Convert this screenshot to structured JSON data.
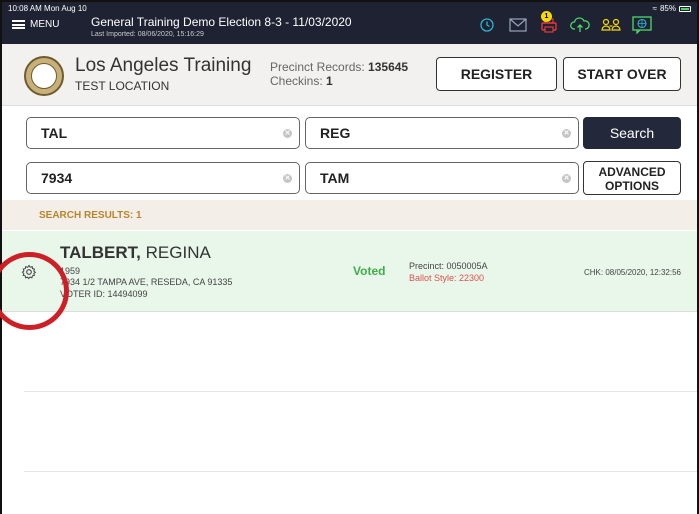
{
  "status_bar": {
    "time": "10:08 AM  Mon Aug 10",
    "battery": "85%"
  },
  "topbar": {
    "menu_label": "MENU",
    "title": "General Training  Demo Election 8-3 - 11/03/2020",
    "subtitle": "Last Imported: 08/06/2020, 15:16:29",
    "notification_count": "1",
    "icons": [
      "history-icon",
      "mail-icon",
      "printer-icon",
      "cloud-upload-icon",
      "users-icon",
      "chat-icon"
    ]
  },
  "header": {
    "org_name": "Los Angeles Training",
    "location": "TEST LOCATION",
    "precinct_records_label": "Precinct Records:",
    "precinct_records_value": "135645",
    "checkins_label": "Checkins:",
    "checkins_value": "1",
    "register_label": "REGISTER",
    "start_over_label": "START OVER"
  },
  "search": {
    "last_name": "TAL",
    "first_name": "REG",
    "house_number": "7934",
    "street": "TAM",
    "search_label": "Search",
    "advanced_line1": "ADVANCED",
    "advanced_line2": "OPTIONS"
  },
  "results": {
    "header": "SEARCH RESULTS: 1",
    "items": [
      {
        "last_name": "TALBERT,",
        "first_name": " REGINA",
        "birth_year": "1959",
        "address": "7934 1/2 TAMPA AVE, RESEDA, CA 91335",
        "voter_id": "VOTER ID: 14494099",
        "status": "Voted",
        "precinct": "Precinct: 0050005A",
        "ballot_style": "Ballot Style: 22300",
        "checked": "CHK: 08/05/2020, 12:32:56"
      }
    ]
  },
  "colors": {
    "topbar": "#1e2233",
    "voted": "#3fae49",
    "ballot": "#d9534f",
    "highlight_circle": "#cc2026",
    "results_header": "#b8862a"
  }
}
